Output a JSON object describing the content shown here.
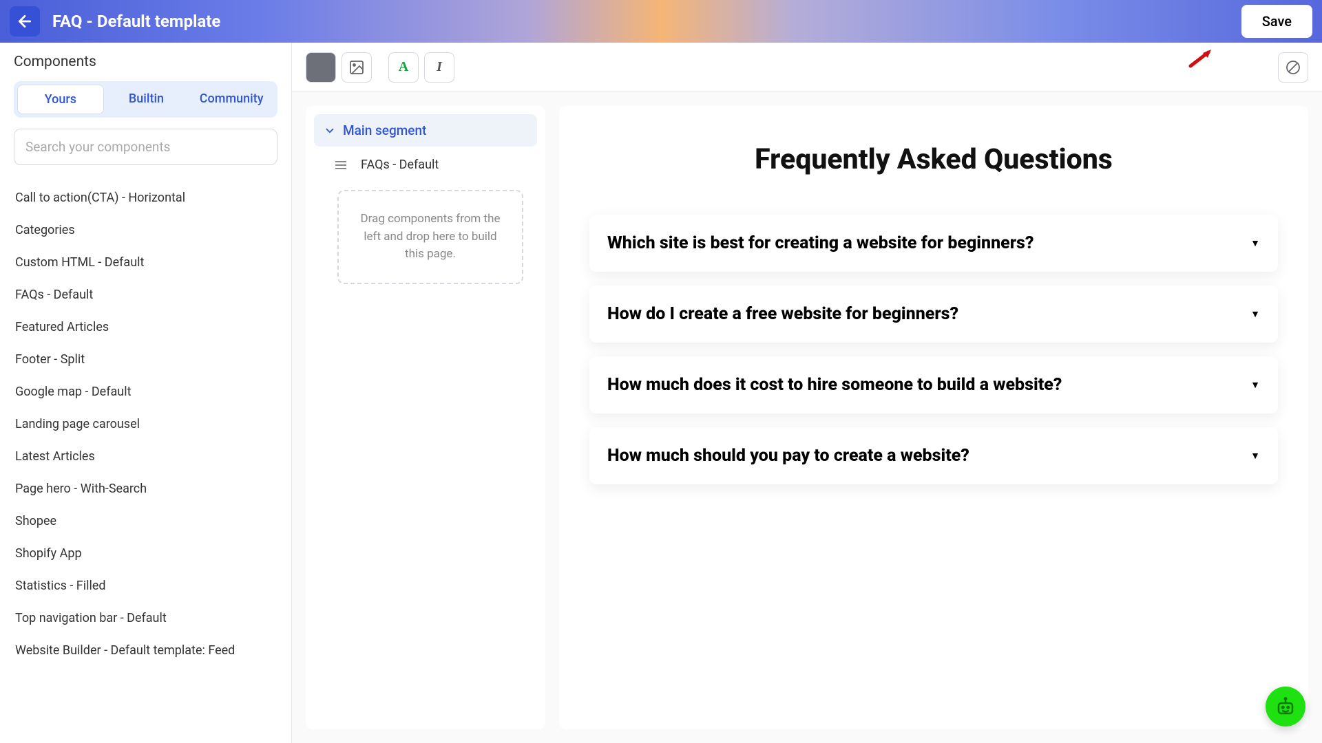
{
  "header": {
    "title": "FAQ - Default template",
    "save_label": "Save"
  },
  "sidebar": {
    "title": "Components",
    "tabs": [
      "Yours",
      "Builtin",
      "Community"
    ],
    "search_placeholder": "Search your components",
    "items": [
      "Call to action(CTA) - Horizontal",
      "Categories",
      "Custom HTML - Default",
      "FAQs - Default",
      "Featured Articles",
      "Footer - Split",
      "Google map - Default",
      "Landing page carousel",
      "Latest Articles",
      "Page hero - With-Search",
      "Shopee",
      "Shopify App",
      "Statistics - Filled",
      "Top navigation bar - Default",
      "Website Builder - Default template: Feed"
    ]
  },
  "tree": {
    "segment_label": "Main segment",
    "child_label": "FAQs - Default",
    "drop_hint": "Drag components from the left and drop here to build this page."
  },
  "preview": {
    "heading": "Frequently Asked Questions",
    "faqs": [
      "Which site is best for creating a website for beginners?",
      "How do I create a free website for beginners?",
      "How much does it cost to hire someone to build a website?",
      "How much should you pay to create a website?"
    ]
  }
}
